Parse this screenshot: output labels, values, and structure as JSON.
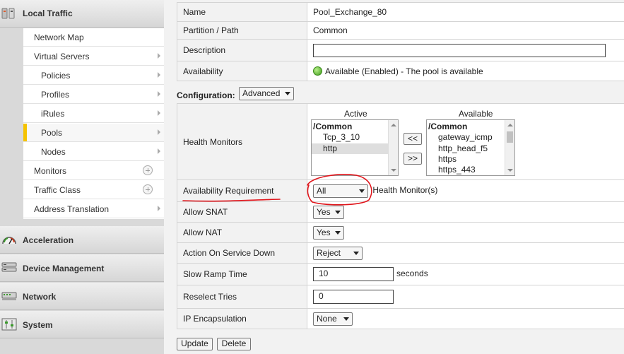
{
  "sidebar": {
    "local_traffic": "Local Traffic",
    "items": [
      {
        "label": "Network Map",
        "icon": "none"
      },
      {
        "label": "Virtual Servers",
        "icon": "chevron-right-icon"
      },
      {
        "label": "Policies",
        "icon": "chevron-right-icon"
      },
      {
        "label": "Profiles",
        "icon": "chevron-right-icon"
      },
      {
        "label": "iRules",
        "icon": "chevron-right-icon"
      },
      {
        "label": "Pools",
        "icon": "chevron-right-icon",
        "active": true
      },
      {
        "label": "Nodes",
        "icon": "chevron-right-icon"
      },
      {
        "label": "Monitors",
        "icon": "plus-circle-icon"
      },
      {
        "label": "Traffic Class",
        "icon": "plus-circle-icon"
      },
      {
        "label": "Address Translation",
        "icon": "chevron-right-icon"
      }
    ],
    "sections": [
      "Acceleration",
      "Device Management",
      "Network",
      "System"
    ]
  },
  "general": {
    "name_label": "Name",
    "name_value": "Pool_Exchange_80",
    "partition_label": "Partition / Path",
    "partition_value": "Common",
    "description_label": "Description",
    "description_value": "",
    "availability_label": "Availability",
    "availability_value": "Available (Enabled) - The pool is available"
  },
  "configuration": {
    "label": "Configuration:",
    "mode": "Advanced"
  },
  "monitors": {
    "label": "Health Monitors",
    "active_header": "Active",
    "available_header": "Available",
    "active_items": [
      "/Common",
      "Tcp_3_10",
      "http"
    ],
    "available_items": [
      "/Common",
      "gateway_icmp",
      "http_head_f5",
      "https",
      "https_443"
    ],
    "add_button": "<<",
    "remove_button": ">>"
  },
  "settings": {
    "availability_req_label": "Availability Requirement",
    "availability_req_value": "All",
    "availability_req_suffix": "Health Monitor(s)",
    "allow_snat_label": "Allow SNAT",
    "allow_snat_value": "Yes",
    "allow_nat_label": "Allow NAT",
    "allow_nat_value": "Yes",
    "action_down_label": "Action On Service Down",
    "action_down_value": "Reject",
    "slow_ramp_label": "Slow Ramp Time",
    "slow_ramp_value": "10",
    "slow_ramp_unit": "seconds",
    "reselect_label": "Reselect Tries",
    "reselect_value": "0",
    "ip_encap_label": "IP Encapsulation",
    "ip_encap_value": "None"
  },
  "actions": {
    "update": "Update",
    "delete": "Delete"
  },
  "annotation_color": "#e0151b"
}
